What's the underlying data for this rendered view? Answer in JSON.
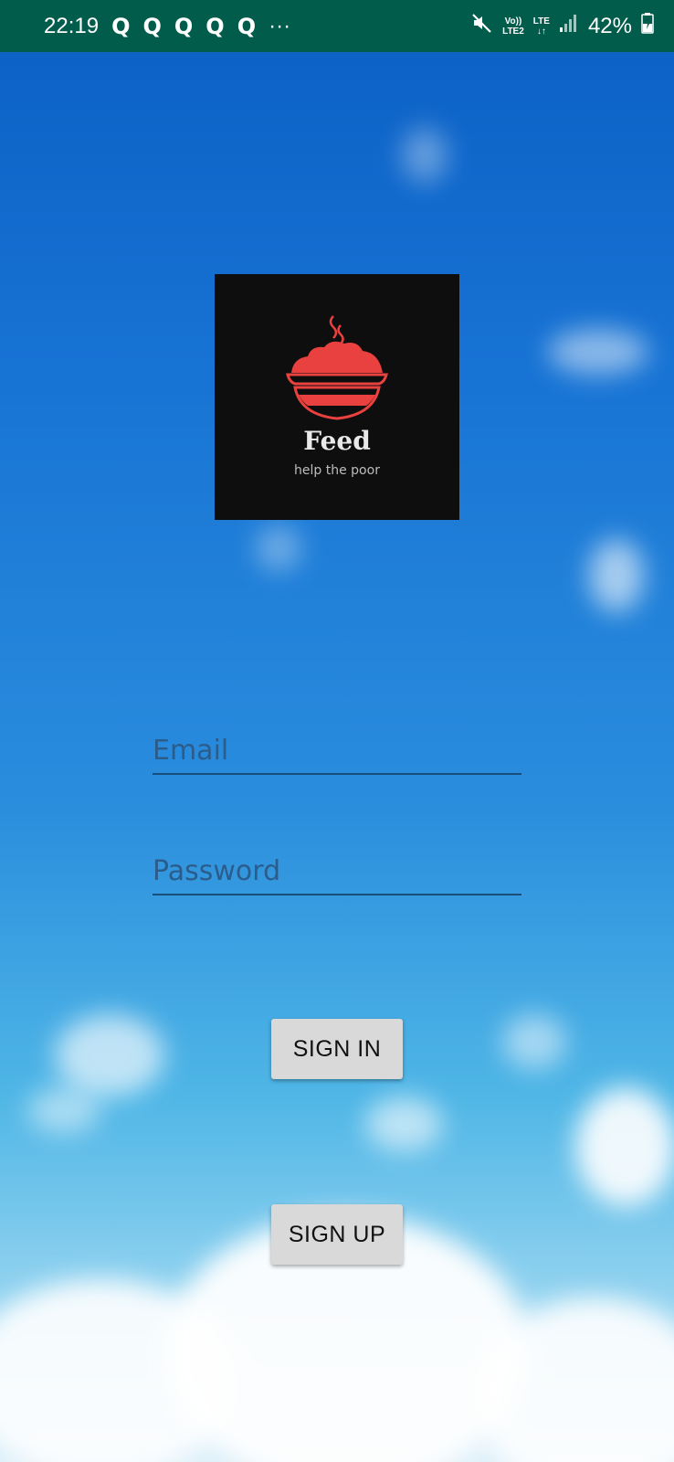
{
  "status_bar": {
    "time": "22:19",
    "notification_icons": [
      "Q",
      "Q",
      "Q",
      "Q",
      "Q"
    ],
    "more_indicator": "···",
    "volte_top": "Vo))",
    "volte_bottom": "LTE2",
    "network_top": "LTE",
    "network_bottom": "↓↑",
    "battery": "42%",
    "icons": [
      "mute-icon",
      "signal-icon",
      "battery-charging-icon"
    ]
  },
  "logo": {
    "name": "Feed",
    "tagline": "help the poor",
    "bowl_color": "#e8413f",
    "background_color": "#0e0e0e"
  },
  "form": {
    "email_placeholder": "Email",
    "email_value": "",
    "password_placeholder": "Password",
    "password_value": ""
  },
  "buttons": {
    "sign_in_label": "SIGN IN",
    "sign_up_label": "SIGN UP"
  },
  "colors": {
    "status_bar": "#025c4c",
    "sky_top": "#0b5fc4",
    "sky_bottom": "#d9eef8",
    "button_bg": "#d9d9d9"
  }
}
